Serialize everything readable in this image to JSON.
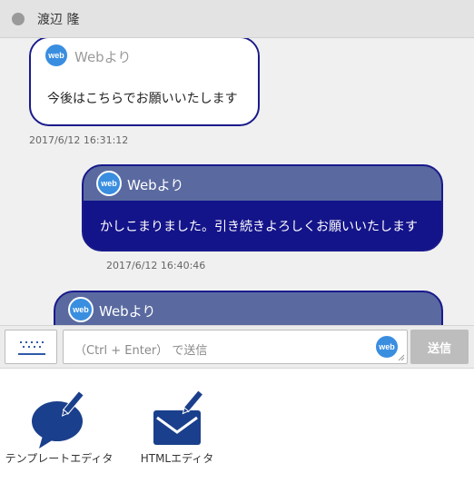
{
  "header": {
    "contact_name": "渡辺 隆"
  },
  "messages": [
    {
      "direction": "in",
      "from": "Webより",
      "text": "今後はこちらでお願いいたします",
      "timestamp": "2017/6/12 16:31:12"
    },
    {
      "direction": "out",
      "from": "Webより",
      "text": "かしこまりました。引き続きよろしくお願いいたします",
      "timestamp": "2017/6/12 16:40:46"
    },
    {
      "direction": "out",
      "from": "Webより"
    }
  ],
  "input": {
    "placeholder": "（Ctrl + Enter） で送信",
    "send_label": "送信"
  },
  "tools": [
    {
      "label": "テンプレートエディタ",
      "icon": "template-editor-icon"
    },
    {
      "label": "HTMLエディタ",
      "icon": "html-editor-icon"
    }
  ],
  "icons": {
    "channel": "web-icon",
    "keyboard": "keyboard-icon"
  },
  "colors": {
    "outgoing_head": "#5a6aa0",
    "outgoing_body": "#14148a",
    "web_badge": "#3a8ee0",
    "tool_icon": "#1a3f8c"
  }
}
